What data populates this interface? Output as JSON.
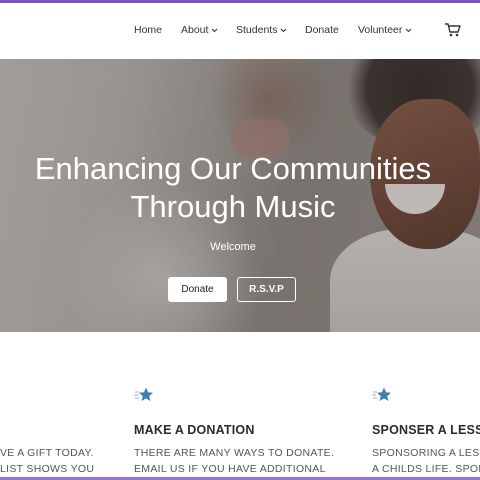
{
  "nav": {
    "items": [
      {
        "label": "Home",
        "has_dropdown": false
      },
      {
        "label": "About",
        "has_dropdown": true
      },
      {
        "label": "Students",
        "has_dropdown": true
      },
      {
        "label": "Donate",
        "has_dropdown": false
      },
      {
        "label": "Volunteer",
        "has_dropdown": true
      }
    ],
    "chevron": "⌄",
    "cart_icon": "cart-icon"
  },
  "hero": {
    "title": "Enhancing Our Communities Through Music",
    "subtitle": "Welcome",
    "donate_label": "Donate",
    "rsvp_label": "R.S.V.P"
  },
  "cards": [
    {
      "title": "",
      "lines": [
        "VE A GIFT TODAY.",
        "LIST SHOWS YOU"
      ],
      "icon": "none"
    },
    {
      "title": "MAKE A DONATION",
      "lines": [
        "THERE ARE MANY WAYS TO DONATE.",
        "EMAIL US IF YOU HAVE ADDITIONAL"
      ],
      "icon": "star-icon"
    },
    {
      "title": "SPONSER A LESSO",
      "lines": [
        "SPONSORING A LESSO",
        "A CHILDS LIFE. SPONS"
      ],
      "icon": "star-icon"
    }
  ],
  "colors": {
    "accent": "#7a52c6",
    "star": "#3f7fae"
  }
}
